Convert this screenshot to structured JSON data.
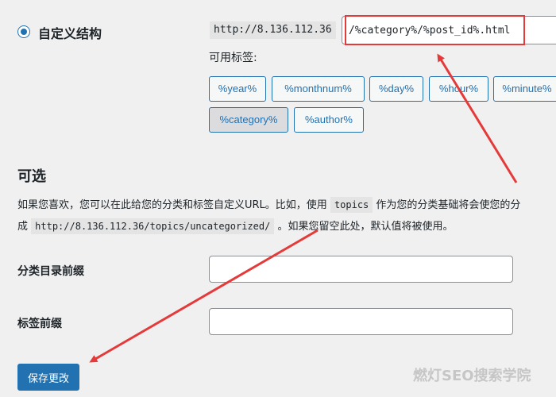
{
  "permalink": {
    "custom_label": "自定义结构",
    "url_prefix": "http://8.136.112.36",
    "structure_value": "/%category%/%post_id%.html",
    "tags_label": "可用标签:",
    "tags": [
      "%year%",
      "%monthnum%",
      "%day%",
      "%hour%",
      "%minute%",
      "%category%",
      "%author%"
    ],
    "active_tag": "%category%"
  },
  "optional": {
    "title": "可选",
    "desc_line1_pre": "如果您喜欢，您可以在此给您的分类和标签自定义URL。比如，使用 ",
    "desc_code1": "topics",
    "desc_line1_post": " 作为您的分类基础将会使您的分",
    "desc_line2_pre": "成 ",
    "desc_code2": "http://8.136.112.36/topics/uncategorized/",
    "desc_line2_post": " 。如果您留空此处，默认值将被使用。",
    "category_base_label": "分类目录前缀",
    "category_base_value": "",
    "tag_base_label": "标签前缀",
    "tag_base_value": ""
  },
  "save_label": "保存更改",
  "watermark": "燃灯SEO搜索学院",
  "colors": {
    "accent": "#2271b1",
    "annotation": "#e53a3a"
  }
}
